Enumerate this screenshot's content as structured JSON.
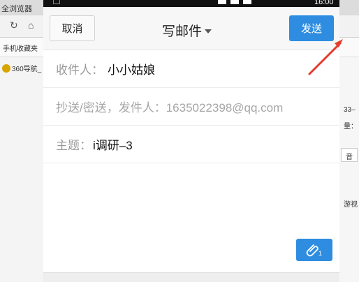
{
  "background_browser": {
    "title_fragment": "全浏览器",
    "favorites_fragment": "手机收藏夹",
    "nav_fragment": "360导航_",
    "right_fragments": [
      "33–",
      "量：",
      "音",
      "游视"
    ]
  },
  "status_bar": {
    "time": "16:00"
  },
  "compose": {
    "cancel_label": "取消",
    "title": "写邮件",
    "send_label": "发送",
    "to_label": "收件人：",
    "to_value": "小小姑娘",
    "cc_label": "抄送/密送，发件人：1635022398@qq.com",
    "subject_label": "主题：",
    "subject_value": "i调研–3",
    "attach_count": "1"
  },
  "colors": {
    "accent": "#2e8de0",
    "annotation_arrow": "#e53b2c"
  },
  "icons": {
    "title_dropdown": "caret-down-icon",
    "attachment": "paperclip-icon",
    "annotation": "red-arrow-annotation"
  }
}
